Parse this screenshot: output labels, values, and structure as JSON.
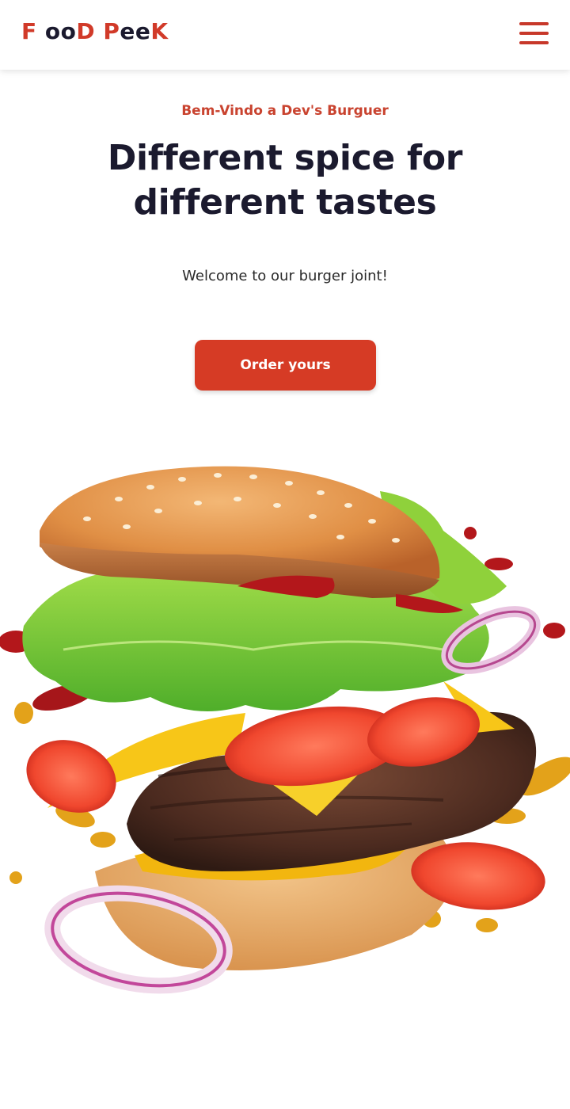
{
  "header": {
    "logo": {
      "p1": "F",
      "p2": " oo",
      "p3": "D ",
      "p4": "P",
      "p5": "ee",
      "p6": "K"
    },
    "menu_icon": "hamburger-menu-icon"
  },
  "hero": {
    "kicker": "Bem-Vindo a Dev's Burguer",
    "headline": "Different spice for different tastes",
    "subtitle": "Welcome to our burger joint!",
    "cta_label": "Order yours"
  },
  "colors": {
    "brand_red": "#d13a29",
    "button_red": "#d63b25",
    "text_dark": "#1b1a2e"
  },
  "media": {
    "hero_image": "burger-illustration"
  }
}
